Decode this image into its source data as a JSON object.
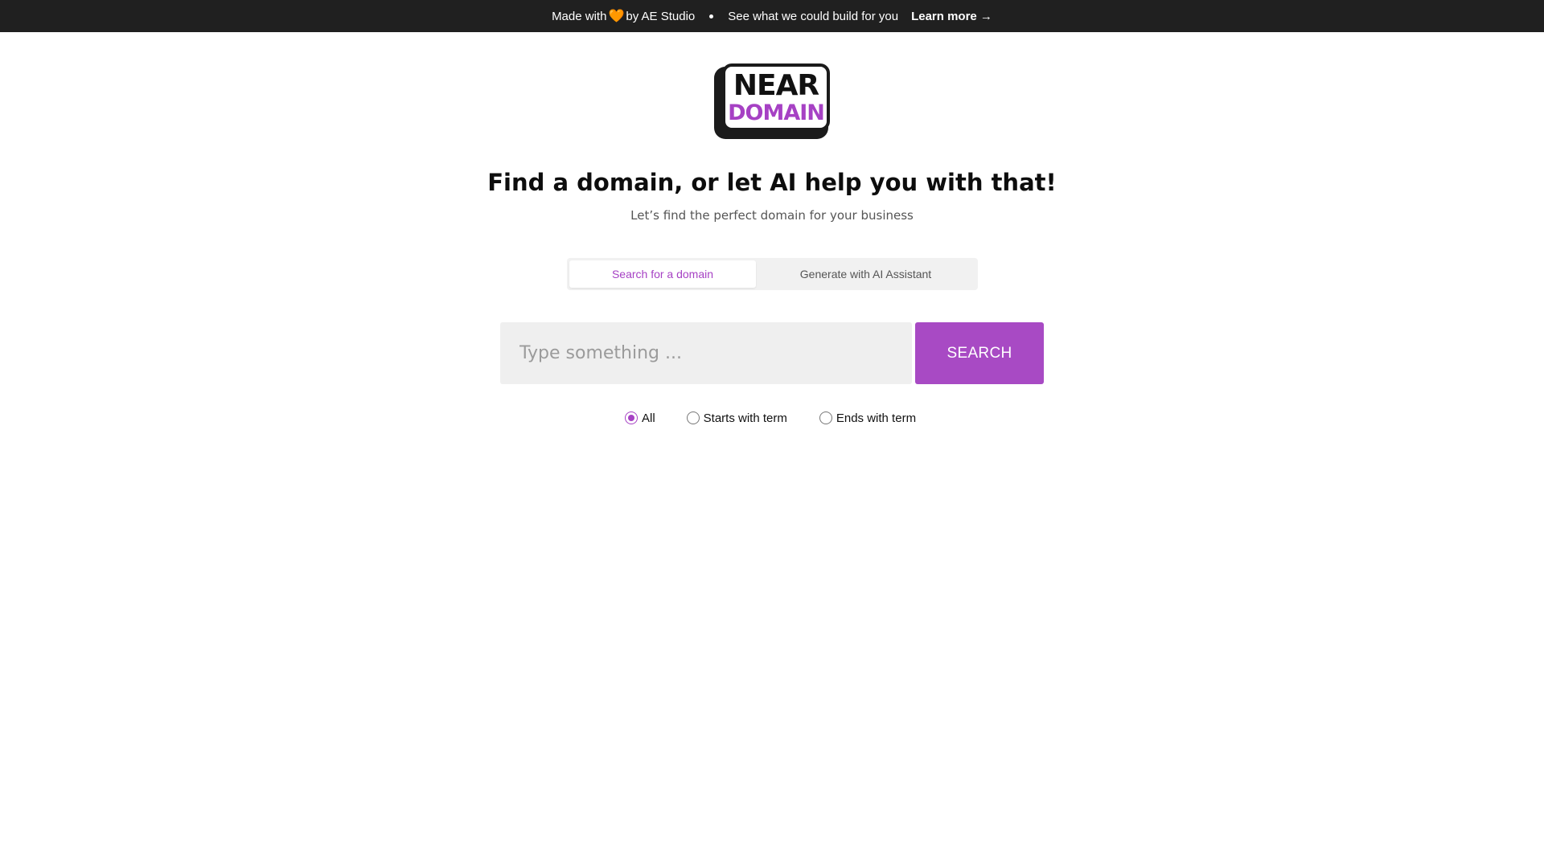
{
  "banner": {
    "made_with": "Made with",
    "heart": "🧡",
    "by": "by AE Studio",
    "pitch": "See what we could build for you",
    "learn_more": "Learn more →"
  },
  "logo": {
    "line1": "NEAR",
    "line2": "DOMAIN"
  },
  "hero": {
    "title": "Find a domain, or let AI help you with that!",
    "subtitle": "Let’s find the perfect domain for your business"
  },
  "tabs": [
    {
      "label": "Search for a domain",
      "active": true
    },
    {
      "label": "Generate with AI Assistant",
      "active": false
    }
  ],
  "search": {
    "placeholder": "Type something ...",
    "value": "",
    "button_label": "SEARCH"
  },
  "filters": {
    "options": [
      {
        "label": "All",
        "checked": true
      },
      {
        "label": "Starts with term",
        "checked": false
      },
      {
        "label": "Ends with term",
        "checked": false
      }
    ]
  },
  "colors": {
    "accent": "#a641c4",
    "banner_bg": "#202020",
    "heart": "#f58a1f"
  }
}
